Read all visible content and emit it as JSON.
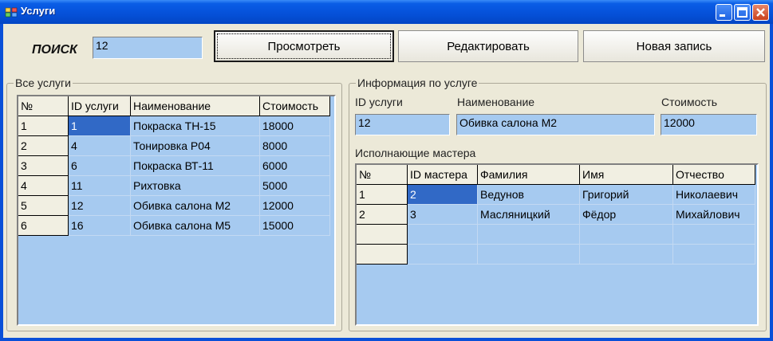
{
  "window": {
    "title": "Услуги"
  },
  "search": {
    "label": "ПОИСК",
    "value": "12"
  },
  "buttons": {
    "view": "Просмотреть",
    "edit": "Редактировать",
    "new": "Новая запись"
  },
  "services": {
    "group_title": "Все услуги",
    "columns": [
      "№",
      "ID услуги",
      "Наименование",
      "Стоимость"
    ],
    "rows": [
      [
        "1",
        "1",
        "Покраска ТН-15",
        "18000"
      ],
      [
        "2",
        "4",
        "Тонировка Р04",
        "8000"
      ],
      [
        "3",
        "6",
        "Покраска ВТ-11",
        "6000"
      ],
      [
        "4",
        "11",
        "Рихтовка",
        "5000"
      ],
      [
        "5",
        "12",
        "Обивка салона М2",
        "12000"
      ],
      [
        "6",
        "16",
        "Обивка салона М5",
        "15000"
      ]
    ]
  },
  "info": {
    "group_title": "Информация по услуге",
    "id_label": "ID услуги",
    "id_value": "12",
    "name_label": "Наименование",
    "name_value": "Обивка салона М2",
    "cost_label": "Стоимость",
    "cost_value": "12000",
    "masters_label": "Исполнающие мастера",
    "masters_columns": [
      "№",
      "ID мастера",
      "Фамилия",
      "Имя",
      "Отчество"
    ],
    "masters_rows": [
      [
        "1",
        "2",
        "Ведунов",
        "Григорий",
        "Николаевич"
      ],
      [
        "2",
        "3",
        "Масляницкий",
        "Фёдор",
        "Михайлович"
      ]
    ]
  }
}
